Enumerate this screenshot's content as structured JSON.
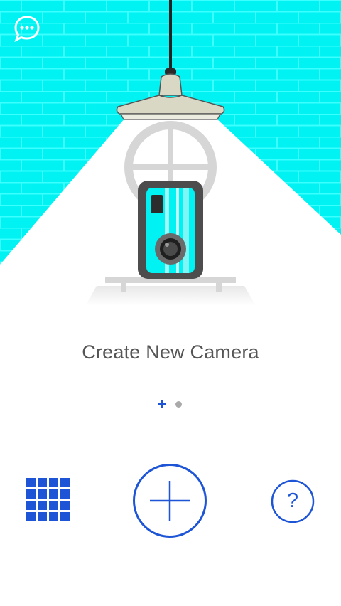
{
  "main": {
    "title": "Create New Camera"
  },
  "pager": {
    "page_count": 2,
    "current_page": 1
  },
  "toolbar": {
    "icons": {
      "left": "grid-icon",
      "center": "add-icon",
      "right": "help-icon"
    },
    "help_glyph": "?"
  },
  "header": {
    "chat_icon": "chat-bubble-icon"
  },
  "colors": {
    "brick_wall": "#00f2f2",
    "accent_blue": "#1d55d6",
    "title_text": "#555555"
  }
}
